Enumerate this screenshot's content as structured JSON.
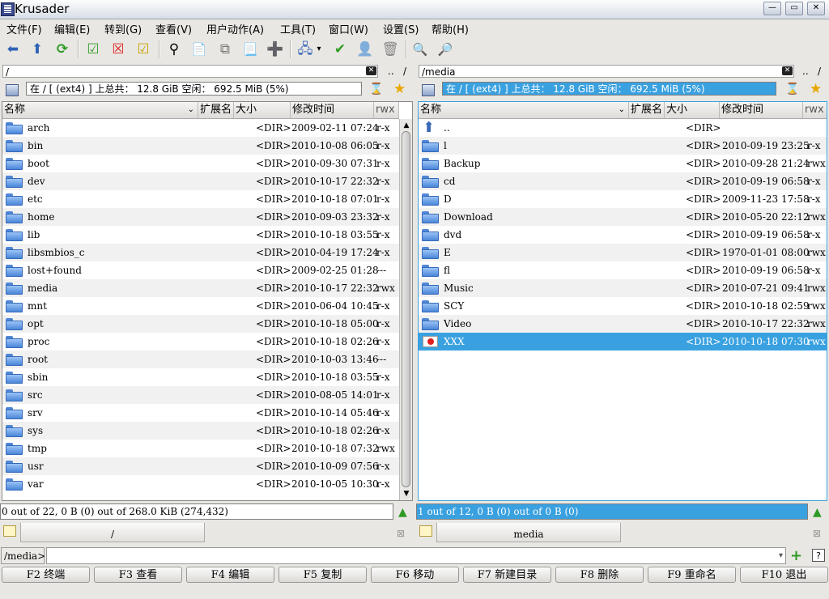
{
  "window": {
    "title": "Krusader",
    "buttons": [
      "—",
      "▭",
      "✕"
    ]
  },
  "menu": [
    "文件(F)",
    "编辑(E)",
    "转到(G)",
    "查看(V)",
    "用户动作(A)",
    "工具(T)",
    "窗口(W)",
    "设置(S)",
    "帮助(H)"
  ],
  "toolbar": [
    {
      "name": "back-icon",
      "glyph": "⬅"
    },
    {
      "name": "up-icon",
      "glyph": "⬆"
    },
    {
      "name": "reload-icon",
      "glyph": "⟳"
    },
    {
      "name": "select-all-icon",
      "glyph": "☑"
    },
    {
      "name": "unselect-icon",
      "glyph": "☒"
    },
    {
      "name": "invert-selection-icon",
      "glyph": "☑"
    },
    {
      "name": "search-icon",
      "glyph": "⚲"
    },
    {
      "name": "new-file-icon",
      "glyph": "📄"
    },
    {
      "name": "copy-file-icon",
      "glyph": "⧉"
    },
    {
      "name": "paste-file-icon",
      "glyph": "📃"
    },
    {
      "name": "add-file-icon",
      "glyph": "➕"
    },
    {
      "name": "network-icon",
      "glyph": "🖧"
    },
    {
      "name": "checklist-icon",
      "glyph": "✔"
    },
    {
      "name": "user-icon",
      "glyph": "👤"
    },
    {
      "name": "trash-icon",
      "glyph": "🗑"
    },
    {
      "name": "zoom-in-icon",
      "glyph": "🔍"
    },
    {
      "name": "zoom-out-icon",
      "glyph": "🔎"
    }
  ],
  "columns": {
    "name": "名称",
    "ext": "扩展名",
    "size": "大小",
    "mtime": "修改时间",
    "perm": "rwx"
  },
  "left": {
    "path": "/",
    "dotdot": "..",
    "slash": "/",
    "status": "在 / [ (ext4) ] 上总共：  12.8 GiB 空闲：  692.5 MiB (5%)",
    "info": "0 out of 22, 0 B (0) out of 268.0 KiB (274,432)",
    "tab": "/",
    "rows": [
      {
        "name": "arch",
        "size": "<DIR>",
        "mtime": "2009-02-11 07:24",
        "perm": "r-x"
      },
      {
        "name": "bin",
        "size": "<DIR>",
        "mtime": "2010-10-08 06:05",
        "perm": "r-x"
      },
      {
        "name": "boot",
        "size": "<DIR>",
        "mtime": "2010-09-30 07:31",
        "perm": "r-x"
      },
      {
        "name": "dev",
        "size": "<DIR>",
        "mtime": "2010-10-17 22:32",
        "perm": "r-x"
      },
      {
        "name": "etc",
        "size": "<DIR>",
        "mtime": "2010-10-18 07:01",
        "perm": "r-x"
      },
      {
        "name": "home",
        "size": "<DIR>",
        "mtime": "2010-09-03 23:32",
        "perm": "r-x"
      },
      {
        "name": "lib",
        "size": "<DIR>",
        "mtime": "2010-10-18 03:55",
        "perm": "r-x"
      },
      {
        "name": "libsmbios_c",
        "size": "<DIR>",
        "mtime": "2010-04-19 17:24",
        "perm": "r-x"
      },
      {
        "name": "lost+found",
        "size": "<DIR>",
        "mtime": "2009-02-25 01:28",
        "perm": "---"
      },
      {
        "name": "media",
        "size": "<DIR>",
        "mtime": "2010-10-17 22:32",
        "perm": "rwx"
      },
      {
        "name": "mnt",
        "size": "<DIR>",
        "mtime": "2010-06-04 10:45",
        "perm": "r-x"
      },
      {
        "name": "opt",
        "size": "<DIR>",
        "mtime": "2010-10-18 05:00",
        "perm": "r-x"
      },
      {
        "name": "proc",
        "size": "<DIR>",
        "mtime": "2010-10-18 02:26",
        "perm": "r-x"
      },
      {
        "name": "root",
        "size": "<DIR>",
        "mtime": "2010-10-03 13:46",
        "perm": "---"
      },
      {
        "name": "sbin",
        "size": "<DIR>",
        "mtime": "2010-10-18 03:55",
        "perm": "r-x"
      },
      {
        "name": "src",
        "size": "<DIR>",
        "mtime": "2010-08-05 14:01",
        "perm": "r-x"
      },
      {
        "name": "srv",
        "size": "<DIR>",
        "mtime": "2010-10-14 05:46",
        "perm": "r-x"
      },
      {
        "name": "sys",
        "size": "<DIR>",
        "mtime": "2010-10-18 02:26",
        "perm": "r-x"
      },
      {
        "name": "tmp",
        "size": "<DIR>",
        "mtime": "2010-10-18 07:32",
        "perm": "rwx"
      },
      {
        "name": "usr",
        "size": "<DIR>",
        "mtime": "2010-10-09 07:56",
        "perm": "r-x"
      },
      {
        "name": "var",
        "size": "<DIR>",
        "mtime": "2010-10-05 10:30",
        "perm": "r-x"
      }
    ]
  },
  "right": {
    "path": "/media",
    "dotdot": "..",
    "slash": "/",
    "status": "在 / [ (ext4) ] 上总共：  12.8 GiB 空闲：  692.5 MiB (5%)",
    "info": "1 out of 12, 0 B (0) out of 0 B (0)",
    "tab": "media",
    "rows": [
      {
        "name": "..",
        "size": "<DIR>",
        "mtime": "",
        "perm": "",
        "up": true
      },
      {
        "name": "l",
        "size": "<DIR>",
        "mtime": "2010-09-19 23:25",
        "perm": "r-x"
      },
      {
        "name": "Backup",
        "size": "<DIR>",
        "mtime": "2010-09-28 21:24",
        "perm": "rwx"
      },
      {
        "name": "cd",
        "size": "<DIR>",
        "mtime": "2010-09-19 06:58",
        "perm": "r-x"
      },
      {
        "name": "D",
        "size": "<DIR>",
        "mtime": "2009-11-23 17:58",
        "perm": "r-x"
      },
      {
        "name": "Download",
        "size": "<DIR>",
        "mtime": "2010-05-20 22:12",
        "perm": "rwx"
      },
      {
        "name": "dvd",
        "size": "<DIR>",
        "mtime": "2010-09-19 06:58",
        "perm": "r-x"
      },
      {
        "name": "E",
        "size": "<DIR>",
        "mtime": "1970-01-01 08:00",
        "perm": "rwx"
      },
      {
        "name": "fl",
        "size": "<DIR>",
        "mtime": "2010-09-19 06:58",
        "perm": "r-x"
      },
      {
        "name": "Music",
        "size": "<DIR>",
        "mtime": "2010-07-21 09:41",
        "perm": "rwx"
      },
      {
        "name": "SCY",
        "size": "<DIR>",
        "mtime": "2010-10-18 02:59",
        "perm": "rwx"
      },
      {
        "name": "Video",
        "size": "<DIR>",
        "mtime": "2010-10-17 22:32",
        "perm": "rwx"
      },
      {
        "name": "XXX",
        "size": "<DIR>",
        "mtime": "2010-10-18 07:30",
        "perm": "rwx",
        "selected": true,
        "special": true
      }
    ]
  },
  "cmdline": {
    "label": "/media>",
    "value": ""
  },
  "fkeys": [
    {
      "num": "F2",
      "label": "终端"
    },
    {
      "num": "F3",
      "label": "查看"
    },
    {
      "num": "F4",
      "label": "编辑"
    },
    {
      "num": "F5",
      "label": "复制"
    },
    {
      "num": "F6",
      "label": "移动"
    },
    {
      "num": "F7",
      "label": "新建目录"
    },
    {
      "num": "F8",
      "label": "删除"
    },
    {
      "num": "F9",
      "label": "重命名"
    },
    {
      "num": "F10",
      "label": "退出"
    }
  ],
  "colors": {
    "accent": "#3aa1e0",
    "folder": "#4a86d8"
  }
}
